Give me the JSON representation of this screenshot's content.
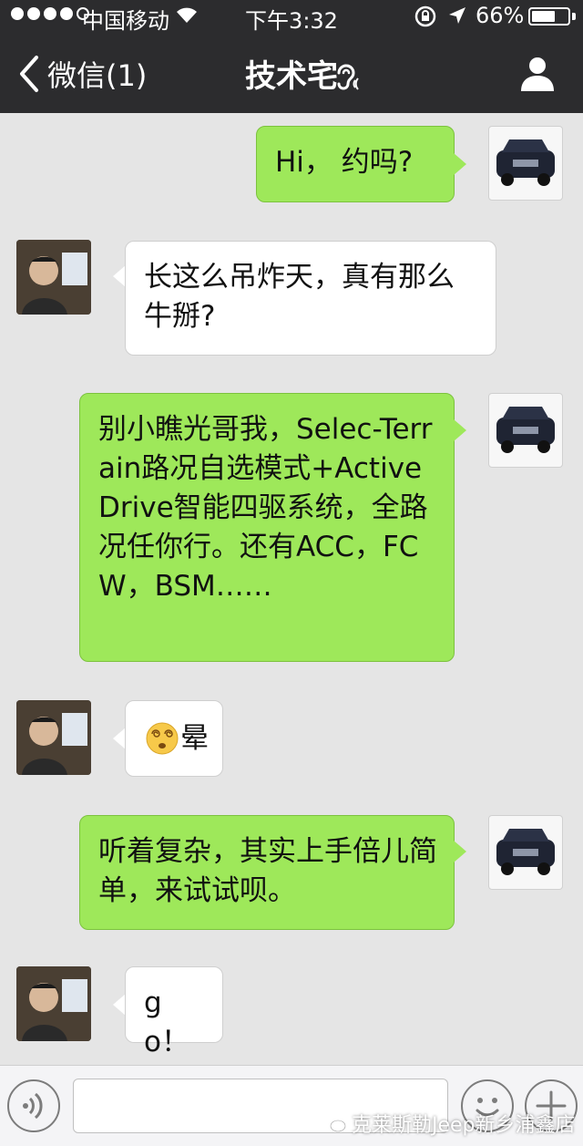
{
  "status_bar": {
    "carrier": "中国移动",
    "time": "下午3:32",
    "battery_percent": "66%",
    "battery_level": 0.66,
    "signal_dots_filled": 4,
    "signal_dots_total": 5
  },
  "nav": {
    "back_label": "微信(1)",
    "title": "技术宅",
    "icons": [
      "back-arrow-icon",
      "ear-icon",
      "profile-icon"
    ]
  },
  "messages": [
    {
      "side": "right",
      "text": "Hi， 约吗?"
    },
    {
      "side": "left",
      "text": "长这么吊炸天，真有那么牛掰?"
    },
    {
      "side": "right",
      "text": "别小瞧光哥我，Selec-Terrain路况自选模式+Active Drive智能四驱系统，全路况任你行。还有ACC，FCW，BSM……"
    },
    {
      "side": "left",
      "emoji": "dizzy-face",
      "text": "晕"
    },
    {
      "side": "right",
      "text": "听着复杂，其实上手倍儿简单，来试试呗。"
    },
    {
      "side": "left",
      "text": "go！"
    }
  ],
  "input_bar": {
    "placeholder": "",
    "icons": [
      "voice-icon",
      "emoji-icon",
      "plus-icon"
    ]
  },
  "watermark": "克莱斯勒Jeep新乡浦鑫店",
  "colors": {
    "header_bg": "#2c2c2e",
    "chat_bg": "#e5e5e5",
    "sent_bubble": "#9ee85a",
    "received_bubble": "#ffffff"
  }
}
